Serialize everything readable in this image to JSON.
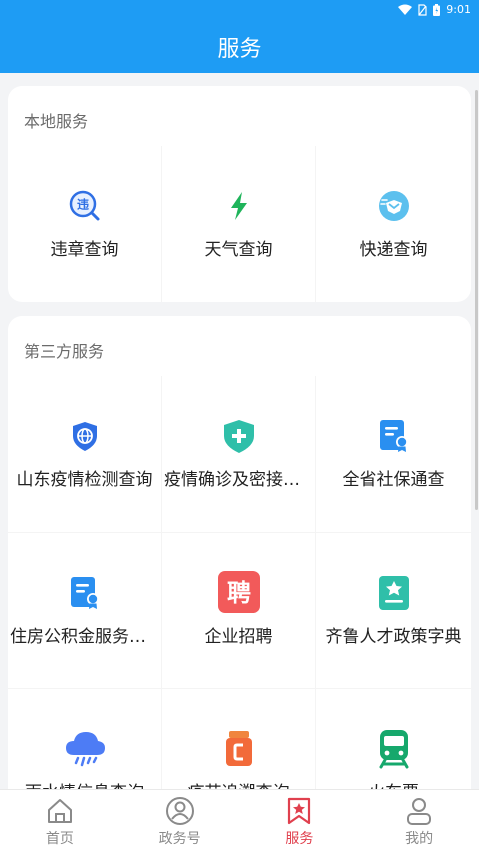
{
  "status": {
    "time": "9:01"
  },
  "header": {
    "title": "服务"
  },
  "local": {
    "title": "本地服务",
    "items": [
      {
        "label": "违章查询",
        "icon": "violation-search-icon"
      },
      {
        "label": "天气查询",
        "icon": "lightning-icon"
      },
      {
        "label": "快递查询",
        "icon": "delivery-icon"
      }
    ]
  },
  "third": {
    "title": "第三方服务",
    "items": [
      {
        "label": "山东疫情检测查询",
        "icon": "shield-globe-icon"
      },
      {
        "label": "疫情确诊及密接查询",
        "icon": "shield-plus-icon"
      },
      {
        "label": "全省社保通查",
        "icon": "certificate-icon"
      },
      {
        "label": "住房公积金服务大厅",
        "icon": "certificate-icon"
      },
      {
        "label": "企业招聘",
        "icon": "recruit-icon"
      },
      {
        "label": "齐鲁人才政策字典",
        "icon": "star-document-icon"
      },
      {
        "label": "雨水情信息查询",
        "icon": "rain-cloud-icon"
      },
      {
        "label": "疫苗追溯查询",
        "icon": "vaccine-icon"
      },
      {
        "label": "火车票",
        "icon": "train-icon"
      }
    ]
  },
  "tabs": [
    {
      "label": "首页",
      "icon": "home-icon"
    },
    {
      "label": "政务号",
      "icon": "government-icon"
    },
    {
      "label": "服务",
      "icon": "service-bookmark-icon",
      "active": true
    },
    {
      "label": "我的",
      "icon": "profile-icon"
    }
  ],
  "colors": {
    "primary": "#1e9cf4",
    "active_tab": "#e0404e"
  }
}
